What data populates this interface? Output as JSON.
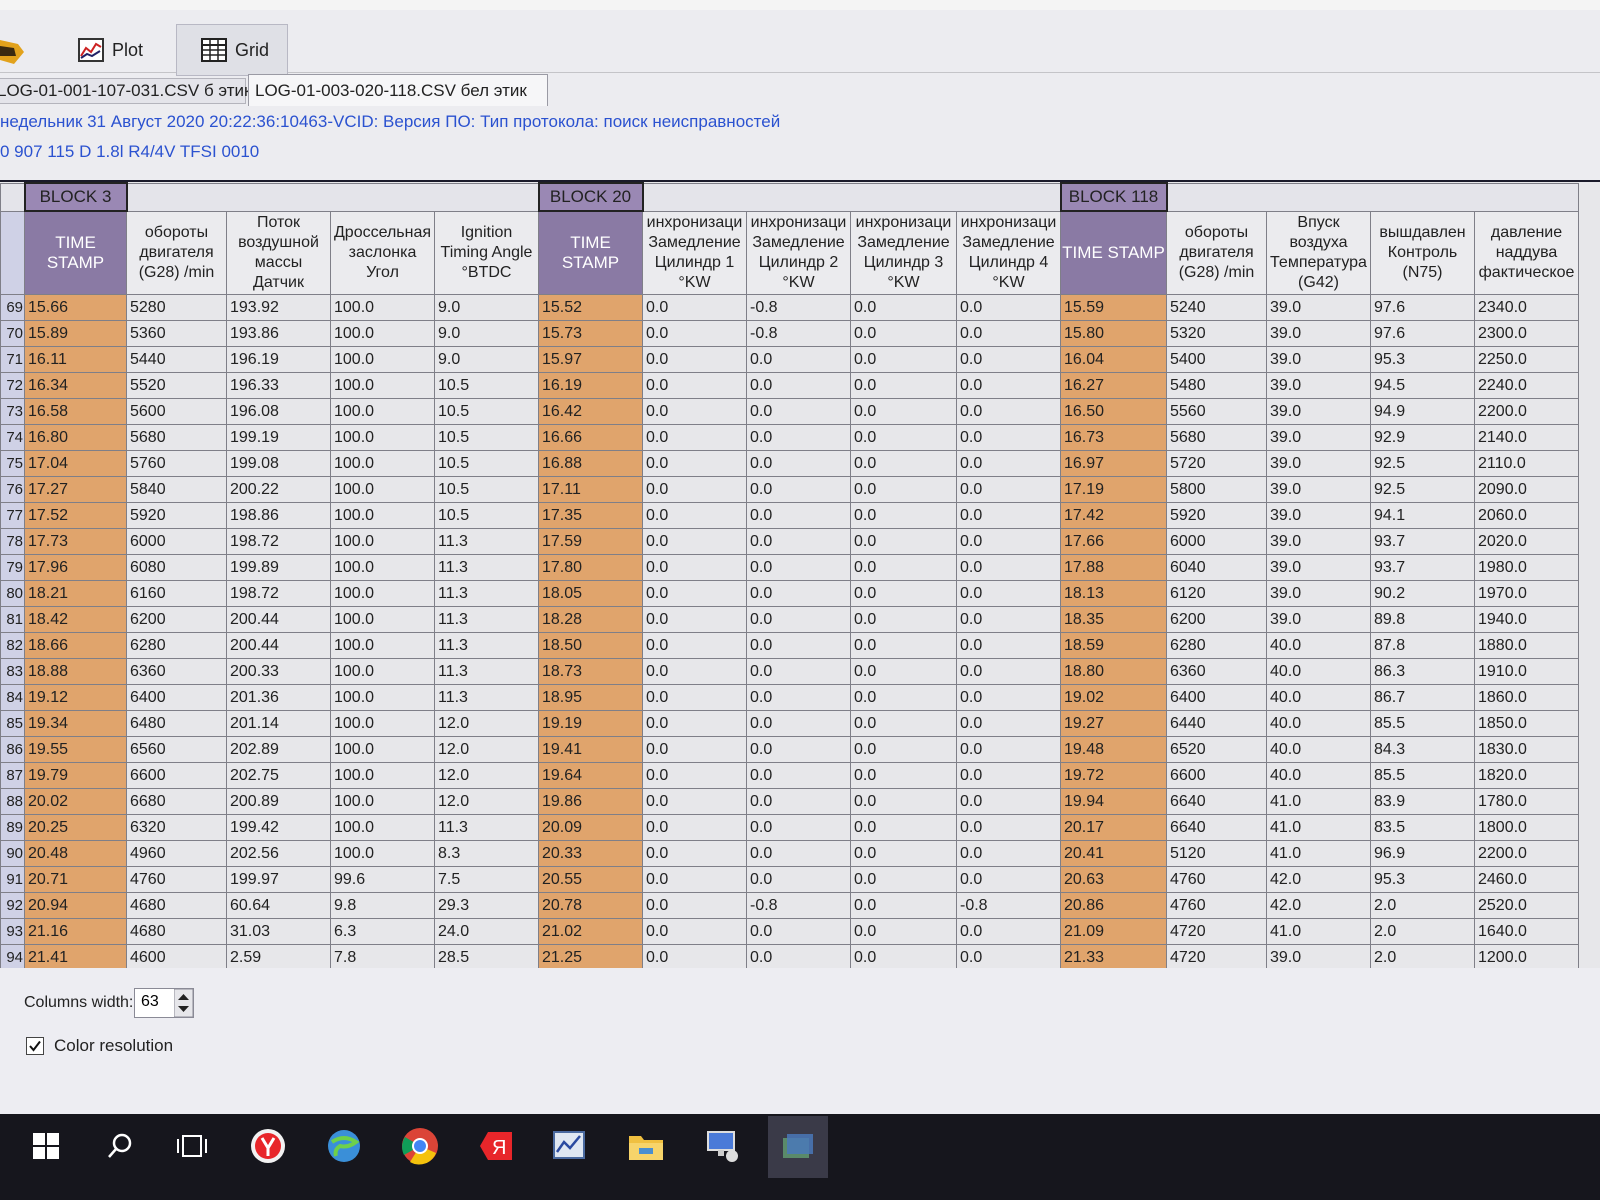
{
  "toolbar": {
    "plot_label": "Plot",
    "grid_label": "Grid"
  },
  "file_tabs": [
    "LOG-01-001-107-031.CSV б этик",
    "LOG-01-003-020-118.CSV бел этик"
  ],
  "info": {
    "line1": "недельник 31 Август 2020 20:22:36:10463-VCID: Версия ПО: Тип протокола: поиск неисправностей",
    "line2": "0 907 115 D  1.8l R4/4V TFSI     0010"
  },
  "blocks": [
    "BLOCK 3",
    "BLOCK 20",
    "BLOCK 118"
  ],
  "columns": [
    "TIME STAMP",
    "обороты двигателя (G28) /min",
    "Поток воздушной массы Датчик",
    "Дроссельная заслонка Угол",
    "Ignition Timing Angle °BTDC",
    "TIME STAMP",
    "инхронизаци Замедление Цилиндр 1 °KW",
    "инхронизаци Замедление Цилиндр 2 °KW",
    "инхронизаци Замедление Цилиндр 3 °KW",
    "инхронизаци Замедление Цилиндр 4 °KW",
    "TIME STAMP",
    "обороты двигателя (G28) /min",
    "Впуск воздуха Температура (G42)",
    "вышдавлен Контроль (N75)",
    "давление наддува фактическое"
  ],
  "rows": [
    [
      "69",
      "15.66",
      "5280",
      "193.92",
      "100.0",
      "9.0",
      "15.52",
      "0.0",
      "-0.8",
      "0.0",
      "0.0",
      "15.59",
      "5240",
      "39.0",
      "97.6",
      "2340.0"
    ],
    [
      "70",
      "15.89",
      "5360",
      "193.86",
      "100.0",
      "9.0",
      "15.73",
      "0.0",
      "-0.8",
      "0.0",
      "0.0",
      "15.80",
      "5320",
      "39.0",
      "97.6",
      "2300.0"
    ],
    [
      "71",
      "16.11",
      "5440",
      "196.19",
      "100.0",
      "9.0",
      "15.97",
      "0.0",
      "0.0",
      "0.0",
      "0.0",
      "16.04",
      "5400",
      "39.0",
      "95.3",
      "2250.0"
    ],
    [
      "72",
      "16.34",
      "5520",
      "196.33",
      "100.0",
      "10.5",
      "16.19",
      "0.0",
      "0.0",
      "0.0",
      "0.0",
      "16.27",
      "5480",
      "39.0",
      "94.5",
      "2240.0"
    ],
    [
      "73",
      "16.58",
      "5600",
      "196.08",
      "100.0",
      "10.5",
      "16.42",
      "0.0",
      "0.0",
      "0.0",
      "0.0",
      "16.50",
      "5560",
      "39.0",
      "94.9",
      "2200.0"
    ],
    [
      "74",
      "16.80",
      "5680",
      "199.19",
      "100.0",
      "10.5",
      "16.66",
      "0.0",
      "0.0",
      "0.0",
      "0.0",
      "16.73",
      "5680",
      "39.0",
      "92.9",
      "2140.0"
    ],
    [
      "75",
      "17.04",
      "5760",
      "199.08",
      "100.0",
      "10.5",
      "16.88",
      "0.0",
      "0.0",
      "0.0",
      "0.0",
      "16.97",
      "5720",
      "39.0",
      "92.5",
      "2110.0"
    ],
    [
      "76",
      "17.27",
      "5840",
      "200.22",
      "100.0",
      "10.5",
      "17.11",
      "0.0",
      "0.0",
      "0.0",
      "0.0",
      "17.19",
      "5800",
      "39.0",
      "92.5",
      "2090.0"
    ],
    [
      "77",
      "17.52",
      "5920",
      "198.86",
      "100.0",
      "10.5",
      "17.35",
      "0.0",
      "0.0",
      "0.0",
      "0.0",
      "17.42",
      "5920",
      "39.0",
      "94.1",
      "2060.0"
    ],
    [
      "78",
      "17.73",
      "6000",
      "198.72",
      "100.0",
      "11.3",
      "17.59",
      "0.0",
      "0.0",
      "0.0",
      "0.0",
      "17.66",
      "6000",
      "39.0",
      "93.7",
      "2020.0"
    ],
    [
      "79",
      "17.96",
      "6080",
      "199.89",
      "100.0",
      "11.3",
      "17.80",
      "0.0",
      "0.0",
      "0.0",
      "0.0",
      "17.88",
      "6040",
      "39.0",
      "93.7",
      "1980.0"
    ],
    [
      "80",
      "18.21",
      "6160",
      "198.72",
      "100.0",
      "11.3",
      "18.05",
      "0.0",
      "0.0",
      "0.0",
      "0.0",
      "18.13",
      "6120",
      "39.0",
      "90.2",
      "1970.0"
    ],
    [
      "81",
      "18.42",
      "6200",
      "200.44",
      "100.0",
      "11.3",
      "18.28",
      "0.0",
      "0.0",
      "0.0",
      "0.0",
      "18.35",
      "6200",
      "39.0",
      "89.8",
      "1940.0"
    ],
    [
      "82",
      "18.66",
      "6280",
      "200.44",
      "100.0",
      "11.3",
      "18.50",
      "0.0",
      "0.0",
      "0.0",
      "0.0",
      "18.59",
      "6280",
      "40.0",
      "87.8",
      "1880.0"
    ],
    [
      "83",
      "18.88",
      "6360",
      "200.33",
      "100.0",
      "11.3",
      "18.73",
      "0.0",
      "0.0",
      "0.0",
      "0.0",
      "18.80",
      "6360",
      "40.0",
      "86.3",
      "1910.0"
    ],
    [
      "84",
      "19.12",
      "6400",
      "201.36",
      "100.0",
      "11.3",
      "18.95",
      "0.0",
      "0.0",
      "0.0",
      "0.0",
      "19.02",
      "6400",
      "40.0",
      "86.7",
      "1860.0"
    ],
    [
      "85",
      "19.34",
      "6480",
      "201.14",
      "100.0",
      "12.0",
      "19.19",
      "0.0",
      "0.0",
      "0.0",
      "0.0",
      "19.27",
      "6440",
      "40.0",
      "85.5",
      "1850.0"
    ],
    [
      "86",
      "19.55",
      "6560",
      "202.89",
      "100.0",
      "12.0",
      "19.41",
      "0.0",
      "0.0",
      "0.0",
      "0.0",
      "19.48",
      "6520",
      "40.0",
      "84.3",
      "1830.0"
    ],
    [
      "87",
      "19.79",
      "6600",
      "202.75",
      "100.0",
      "12.0",
      "19.64",
      "0.0",
      "0.0",
      "0.0",
      "0.0",
      "19.72",
      "6600",
      "40.0",
      "85.5",
      "1820.0"
    ],
    [
      "88",
      "20.02",
      "6680",
      "200.89",
      "100.0",
      "12.0",
      "19.86",
      "0.0",
      "0.0",
      "0.0",
      "0.0",
      "19.94",
      "6640",
      "41.0",
      "83.9",
      "1780.0"
    ],
    [
      "89",
      "20.25",
      "6320",
      "199.42",
      "100.0",
      "11.3",
      "20.09",
      "0.0",
      "0.0",
      "0.0",
      "0.0",
      "20.17",
      "6640",
      "41.0",
      "83.5",
      "1800.0"
    ],
    [
      "90",
      "20.48",
      "4960",
      "202.56",
      "100.0",
      "8.3",
      "20.33",
      "0.0",
      "0.0",
      "0.0",
      "0.0",
      "20.41",
      "5120",
      "41.0",
      "96.9",
      "2200.0"
    ],
    [
      "91",
      "20.71",
      "4760",
      "199.97",
      "99.6",
      "7.5",
      "20.55",
      "0.0",
      "0.0",
      "0.0",
      "0.0",
      "20.63",
      "4760",
      "42.0",
      "95.3",
      "2460.0"
    ],
    [
      "92",
      "20.94",
      "4680",
      "60.64",
      "9.8",
      "29.3",
      "20.78",
      "0.0",
      "-0.8",
      "0.0",
      "-0.8",
      "20.86",
      "4760",
      "42.0",
      "2.0",
      "2520.0"
    ],
    [
      "93",
      "21.16",
      "4680",
      "31.03",
      "6.3",
      "24.0",
      "21.02",
      "0.0",
      "0.0",
      "0.0",
      "0.0",
      "21.09",
      "4720",
      "41.0",
      "2.0",
      "1640.0"
    ],
    [
      "94",
      "21.41",
      "4600",
      "2.59",
      "7.8",
      "28.5",
      "21.25",
      "0.0",
      "0.0",
      "0.0",
      "0.0",
      "21.33",
      "4720",
      "39.0",
      "2.0",
      "1200.0"
    ]
  ],
  "controls": {
    "columns_width_label": "Columns width:",
    "columns_width_value": "63",
    "color_resolution_label": "Color resolution",
    "color_resolution_checked": true
  }
}
